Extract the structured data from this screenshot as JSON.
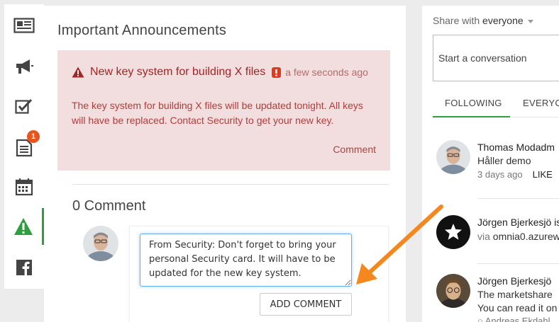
{
  "sidebar": {
    "items": [
      {
        "icon": "newspaper-icon"
      },
      {
        "icon": "megaphone-icon"
      },
      {
        "icon": "checkbox-icon"
      },
      {
        "icon": "document-icon",
        "badge": "1"
      },
      {
        "icon": "calendar-icon"
      },
      {
        "icon": "warning-icon",
        "active": true
      },
      {
        "icon": "facebook-icon"
      }
    ]
  },
  "main": {
    "title": "Important Announcements",
    "announcement": {
      "title": "New key system for building X files",
      "time": "a few seconds ago",
      "body": "The key system for building X files will be updated tonight. All keys will have be replaced. Contact Security to get your new key.",
      "comment_link": "Comment"
    },
    "comment_count": "0 Comment",
    "composer": {
      "value": "From Security: Don't forget to bring your personal Security card. It will have to be updated for the new key system.",
      "button": "ADD COMMENT"
    }
  },
  "right": {
    "share_prefix": "Share with ",
    "share_target": "everyone",
    "placeholder": "Start a conversation",
    "tabs": [
      "FOLLOWING",
      "EVERYONE"
    ],
    "feed": [
      {
        "name": "Thomas Modadm",
        "text": "Håller demo",
        "time": "3 days ago",
        "like": "LIKE"
      },
      {
        "name": "Jörgen Bjerkesjö is",
        "meta_prefix": "via ",
        "meta_link": "omnia0.azurew"
      },
      {
        "name": "Jörgen Bjerkesjö",
        "text": "The marketshare",
        "text2": "You can read it on",
        "text3": "Andreas Ekdahl"
      }
    ]
  },
  "colors": {
    "accent_green": "#2e9e3e",
    "alert_bg": "#f2dede",
    "alert_text": "#a32424",
    "badge": "#e8541c",
    "arrow": "#f5871f"
  }
}
